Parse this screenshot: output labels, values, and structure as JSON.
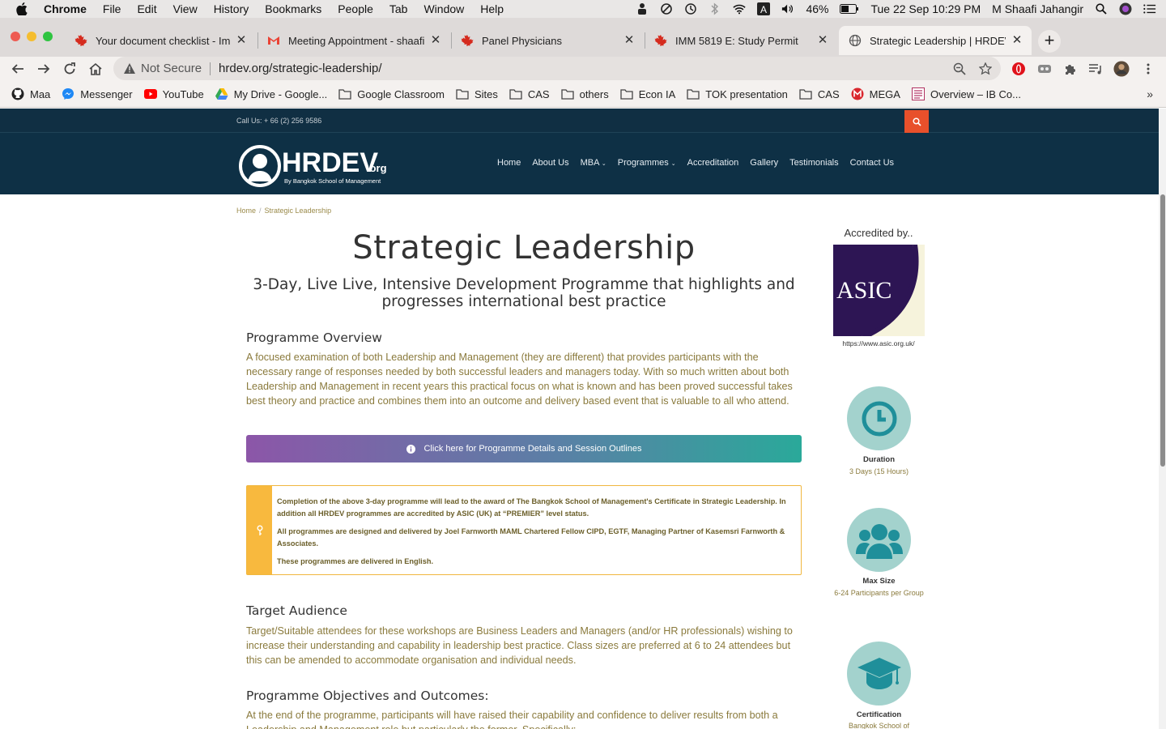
{
  "menubar": {
    "app": "Chrome",
    "items": [
      "File",
      "Edit",
      "View",
      "History",
      "Bookmarks",
      "People",
      "Tab",
      "Window",
      "Help"
    ],
    "battery": "46%",
    "datetime": "Tue 22 Sep  10:29 PM",
    "user": "M Shaafi Jahangir"
  },
  "tabs": [
    {
      "title": "Your document checklist - Imm",
      "icon": "canada-flag-icon"
    },
    {
      "title": "Meeting Appointment - shaafis",
      "icon": "gmail-icon"
    },
    {
      "title": "Panel Physicians",
      "icon": "canada-flag-icon"
    },
    {
      "title": "IMM 5819 E: Study Permit",
      "icon": "canada-flag-icon"
    },
    {
      "title": "Strategic Leadership | HRDEV.org",
      "icon": "globe-icon"
    }
  ],
  "omnibox": {
    "security": "Not Secure",
    "url": "hrdev.org/strategic-leadership/"
  },
  "bookmarks": [
    {
      "label": "Maa",
      "icon": "github-icon"
    },
    {
      "label": "Messenger",
      "icon": "messenger-icon"
    },
    {
      "label": "YouTube",
      "icon": "youtube-icon"
    },
    {
      "label": "My Drive - Google...",
      "icon": "drive-icon"
    },
    {
      "label": "Google Classroom",
      "icon": "folder-icon"
    },
    {
      "label": "Sites",
      "icon": "folder-icon"
    },
    {
      "label": "CAS",
      "icon": "folder-icon"
    },
    {
      "label": "others",
      "icon": "folder-icon"
    },
    {
      "label": "Econ IA",
      "icon": "folder-icon"
    },
    {
      "label": "TOK presentation",
      "icon": "folder-icon"
    },
    {
      "label": "CAS",
      "icon": "folder-icon"
    },
    {
      "label": "MEGA",
      "icon": "mega-icon"
    },
    {
      "label": "Overview – IB Co...",
      "icon": "ib-icon"
    }
  ],
  "site": {
    "call_us": "Call Us: + 66 (2) 256 9586",
    "logo_text": "HRDEV",
    "logo_suffix": ".org",
    "logo_tagline": "By Bangkok School of Management",
    "nav": [
      "Home",
      "About Us",
      "MBA",
      "Programmes",
      "Accreditation",
      "Gallery",
      "Testimonials",
      "Contact Us"
    ],
    "nav_dropdowns": [
      "MBA",
      "Programmes"
    ]
  },
  "breadcrumb": {
    "home": "Home",
    "current": "Strategic Leadership"
  },
  "main": {
    "title": "Strategic Leadership",
    "subtitle": "3-Day, Live Live, Intensive Development Programme that highlights and progresses international best practice",
    "overview_heading": "Programme Overview",
    "overview_text": "A focused examination of both Leadership and Management (they are different) that provides participants with the necessary range of responses needed by both successful leaders and managers today. With so much written about both Leadership and Management in recent years this practical focus on what is known and has been proved successful takes best theory and practice and combines them into an outcome and delivery based event that is valuable to all who attend.",
    "details_button": "Click here for Programme Details and Session Outlines",
    "notice": [
      "Completion of the above 3-day programme will lead to the award of The Bangkok School of Management's Certificate in Strategic Leadership. In addition all HRDEV programmes are accredited by ASIC (UK) at “PREMIER” level status.",
      "All programmes are designed and delivered by Joel Farnworth MAML Chartered Fellow CIPD, EGTF, Managing Partner of Kasemsri Farnworth & Associates.",
      "These programmes are delivered in English."
    ],
    "audience_heading": "Target Audience",
    "audience_text": "Target/Suitable attendees for these workshops are Business Leaders and Managers (and/or HR professionals) wishing to increase their understanding and capability in leadership best practice. Class sizes are preferred at 6 to 24 attendees but this can be amended to accommodate organisation and individual needs.",
    "objectives_heading": "Programme Objectives and Outcomes:",
    "objectives_text": "At the end of the programme, participants will have raised their capability and confidence to deliver results from both a Leadership and Management role but particularly the former. Specifically:"
  },
  "sidebar": {
    "accredited_title": "Accredited by..",
    "asic_logo_text": "ASIC",
    "asic_url": "https://www.asic.org.uk/",
    "duration_label": "Duration",
    "duration_value": "3 Days (15 Hours)",
    "maxsize_label": "Max Size",
    "maxsize_value": "6-24 Participants per Group",
    "cert_label": "Certification",
    "cert_value": "Bangkok School of Management"
  },
  "colors": {
    "nav_bg": "#0e3045",
    "accent_orange": "#e8502b",
    "text_olive": "#8a7a3c",
    "notice_yellow": "#f8b93e",
    "icon_teal": "#a3d2cd",
    "icon_dark_teal": "#1f8f9a"
  }
}
